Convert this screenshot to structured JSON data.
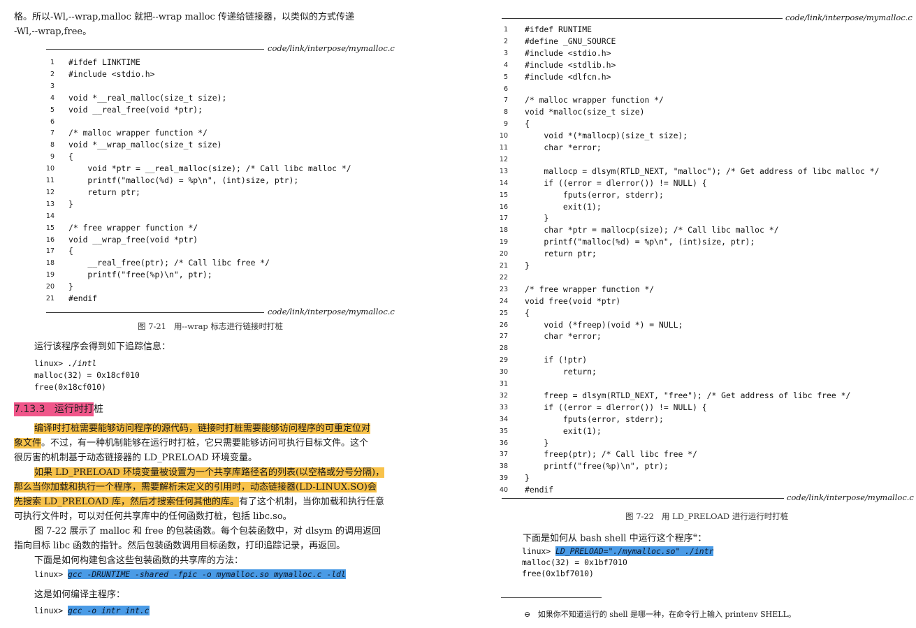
{
  "left": {
    "intro": [
      "格。所以-Wl,--wrap,malloc 就把--wrap malloc 传递给链接器，以类似的方式传递",
      "-Wl,--wrap,free。"
    ],
    "source_label": "code/link/interpose/mymalloc.c",
    "code": [
      {
        "n": "1",
        "t": "#ifdef LINKTIME"
      },
      {
        "n": "2",
        "t": "#include <stdio.h>"
      },
      {
        "n": "3",
        "t": ""
      },
      {
        "n": "4",
        "t": "void *__real_malloc(size_t size);"
      },
      {
        "n": "5",
        "t": "void __real_free(void *ptr);"
      },
      {
        "n": "6",
        "t": ""
      },
      {
        "n": "7",
        "t": "/* malloc wrapper function */"
      },
      {
        "n": "8",
        "t": "void *__wrap_malloc(size_t size)"
      },
      {
        "n": "9",
        "t": "{"
      },
      {
        "n": "10",
        "t": "    void *ptr = __real_malloc(size); /* Call libc malloc */"
      },
      {
        "n": "11",
        "t": "    printf(\"malloc(%d) = %p\\n\", (int)size, ptr);"
      },
      {
        "n": "12",
        "t": "    return ptr;"
      },
      {
        "n": "13",
        "t": "}"
      },
      {
        "n": "14",
        "t": ""
      },
      {
        "n": "15",
        "t": "/* free wrapper function */"
      },
      {
        "n": "16",
        "t": "void __wrap_free(void *ptr)"
      },
      {
        "n": "17",
        "t": "{"
      },
      {
        "n": "18",
        "t": "    __real_free(ptr); /* Call libc free */"
      },
      {
        "n": "19",
        "t": "    printf(\"free(%p)\\n\", ptr);"
      },
      {
        "n": "20",
        "t": "}"
      },
      {
        "n": "21",
        "t": "#endif"
      }
    ],
    "figure_caption": "图 7-21   用--wrap 标志进行链接时打桩",
    "run_text": "运行该程序会得到如下追踪信息：",
    "trace": {
      "prompt": "linux> ",
      "cmd": "./intl",
      "line2": "malloc(32) = 0x18cf010",
      "line3": "free(0x18cf010)"
    },
    "section_num": "7.13.3",
    "section_title_hl": "运行时打",
    "section_title_rest": "桩",
    "p1_hl_a": "编译时打桩需要能够访问程序的源代码，链接时打桩需要能够访问程序的可重定位对",
    "p1_hl_b": "象文件",
    "p1_rest_b": "。不过，有一种机制能够在运行时打桩，它只需要能够访问可执行目标文件。这个",
    "p1_line3": "很厉害的机制基于动态链接器的 LD_PRELOAD 环境变量。",
    "p2_hl_a": "如果 LD_PRELOAD 环境变量被设置为一个共享库路径名的列表(以空格或分号分隔)，",
    "p2_hl_b": "那么当你加载和执行一个程序，需要解析未定义的引用时，动态链接器(LD-LINUX.SO)会",
    "p2_hl_c": "先搜索 LD_PRELOAD 库，然后才搜索任何其他的库。",
    "p2_rest_c": "有了这个机制，当你加载和执行任意",
    "p2_line4": "可执行文件时，可以对任何共享库中的任何函数打桩，包括 libc.so。",
    "p3_line1": "图 7-22 展示了 malloc 和 free 的包装函数。每个包装函数中，对 dlsym 的调用返回",
    "p3_line2": "指向目标 libc 函数的指针。然后包装函数调用目标函数，打印追踪记录，再返回。",
    "p4": "下面是如何构建包含这些包装函数的共享库的方法：",
    "build_prompt": "linux> ",
    "build_cmd": "gcc -DRUNTIME -shared -fpic -o mymalloc.so mymalloc.c -ldl",
    "p5": "这是如何编译主程序：",
    "compile_prompt": "linux> ",
    "compile_cmd": "gcc -o intr int.c"
  },
  "right": {
    "source_label": "code/link/interpose/mymalloc.c",
    "code": [
      {
        "n": "1",
        "t": "#ifdef RUNTIME"
      },
      {
        "n": "2",
        "t": "#define _GNU_SOURCE"
      },
      {
        "n": "3",
        "t": "#include <stdio.h>"
      },
      {
        "n": "4",
        "t": "#include <stdlib.h>"
      },
      {
        "n": "5",
        "t": "#include <dlfcn.h>"
      },
      {
        "n": "6",
        "t": ""
      },
      {
        "n": "7",
        "t": "/* malloc wrapper function */"
      },
      {
        "n": "8",
        "t": "void *malloc(size_t size)"
      },
      {
        "n": "9",
        "t": "{"
      },
      {
        "n": "10",
        "t": "    void *(*mallocp)(size_t size);"
      },
      {
        "n": "11",
        "t": "    char *error;"
      },
      {
        "n": "12",
        "t": ""
      },
      {
        "n": "13",
        "t": "    mallocp = dlsym(RTLD_NEXT, \"malloc\"); /* Get address of libc malloc */"
      },
      {
        "n": "14",
        "t": "    if ((error = dlerror()) != NULL) {"
      },
      {
        "n": "15",
        "t": "        fputs(error, stderr);"
      },
      {
        "n": "16",
        "t": "        exit(1);"
      },
      {
        "n": "17",
        "t": "    }"
      },
      {
        "n": "18",
        "t": "    char *ptr = mallocp(size); /* Call libc malloc */"
      },
      {
        "n": "19",
        "t": "    printf(\"malloc(%d) = %p\\n\", (int)size, ptr);"
      },
      {
        "n": "20",
        "t": "    return ptr;"
      },
      {
        "n": "21",
        "t": "}"
      },
      {
        "n": "22",
        "t": ""
      },
      {
        "n": "23",
        "t": "/* free wrapper function */"
      },
      {
        "n": "24",
        "t": "void free(void *ptr)"
      },
      {
        "n": "25",
        "t": "{"
      },
      {
        "n": "26",
        "t": "    void (*freep)(void *) = NULL;"
      },
      {
        "n": "27",
        "t": "    char *error;"
      },
      {
        "n": "28",
        "t": ""
      },
      {
        "n": "29",
        "t": "    if (!ptr)"
      },
      {
        "n": "30",
        "t": "        return;"
      },
      {
        "n": "31",
        "t": ""
      },
      {
        "n": "32",
        "t": "    freep = dlsym(RTLD_NEXT, \"free\"); /* Get address of libc free */"
      },
      {
        "n": "33",
        "t": "    if ((error = dlerror()) != NULL) {"
      },
      {
        "n": "34",
        "t": "        fputs(error, stderr);"
      },
      {
        "n": "35",
        "t": "        exit(1);"
      },
      {
        "n": "36",
        "t": "    }"
      },
      {
        "n": "37",
        "t": "    freep(ptr); /* Call libc free */"
      },
      {
        "n": "38",
        "t": "    printf(\"free(%p)\\n\", ptr);"
      },
      {
        "n": "39",
        "t": "}"
      },
      {
        "n": "40",
        "t": "#endif"
      }
    ],
    "figure_caption": "图 7-22   用 LD_PRELOAD 进行运行时打桩",
    "run_text": "下面是如何从 bash shell 中运行这个程序",
    "footnote_mark": "⊖",
    "run_text_end": "：",
    "trace": {
      "prompt": "linux> ",
      "cmd": "LD_PRELOAD=\"./mymalloc.so\" ./intr",
      "line2": "malloc(32) = 0x1bf7010",
      "line3": "free(0x1bf7010)"
    },
    "footnote_symbol": "⊖",
    "footnote": "如果你不知道运行的 shell 是哪一种，在命令行上输入 printenv SHELL。"
  },
  "colors": {
    "highlight_yellow": "#f8c24a",
    "highlight_blue": "#4a9be6",
    "highlight_pink": "#f0568a"
  }
}
